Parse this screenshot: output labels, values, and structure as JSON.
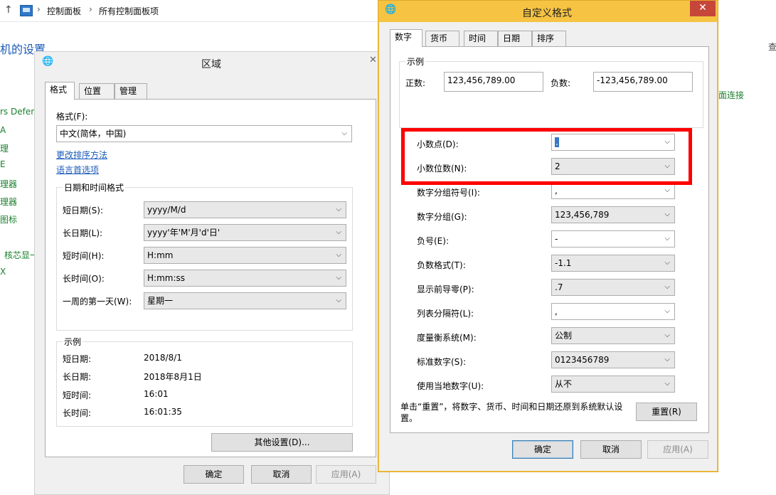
{
  "address_bar": {
    "crumbs": [
      "控制面板",
      "所有控制面板项"
    ]
  },
  "background": {
    "title": "机的设置",
    "items": [
      "rs Defend",
      "A",
      "理",
      "E",
      "理器",
      "理器",
      "图标",
      "核芯显一",
      "X"
    ],
    "right_text_1": "面连接",
    "right_text_2": "查"
  },
  "region_window": {
    "title": "区域",
    "tabs": [
      "格式",
      "位置",
      "管理"
    ],
    "format_label": "格式(F):",
    "format_value": "中文(简体，中国)",
    "link_sort": "更改排序方法",
    "link_lang": "语言首选项",
    "datetime_group": "日期和时间格式",
    "rows": [
      {
        "label": "短日期(S):",
        "value": "yyyy/M/d"
      },
      {
        "label": "长日期(L):",
        "value": "yyyy'年'M'月'd'日'"
      },
      {
        "label": "短时间(H):",
        "value": "H:mm"
      },
      {
        "label": "长时间(O):",
        "value": "H:mm:ss"
      },
      {
        "label": "一周的第一天(W):",
        "value": "星期一"
      }
    ],
    "example_group": "示例",
    "examples": [
      {
        "label": "短日期:",
        "value": "2018/8/1"
      },
      {
        "label": "长日期:",
        "value": "2018年8月1日"
      },
      {
        "label": "短时间:",
        "value": "16:01"
      },
      {
        "label": "长时间:",
        "value": "16:01:35"
      }
    ],
    "more_settings": "其他设置(D)...",
    "ok": "确定",
    "cancel": "取消",
    "apply": "应用(A)"
  },
  "custom_window": {
    "title": "自定义格式",
    "close": "✕",
    "tabs": [
      "数字",
      "货币",
      "时间",
      "日期",
      "排序"
    ],
    "example_group": "示例",
    "positive_label": "正数:",
    "positive_value": "123,456,789.00",
    "negative_label": "负数:",
    "negative_value": "-123,456,789.00",
    "rows": [
      {
        "label": "小数点(D):",
        "value": "."
      },
      {
        "label": "小数位数(N):",
        "value": "2"
      },
      {
        "label": "数字分组符号(I):",
        "value": ","
      },
      {
        "label": "数字分组(G):",
        "value": "123,456,789"
      },
      {
        "label": "负号(E):",
        "value": "-"
      },
      {
        "label": "负数格式(T):",
        "value": "-1.1"
      },
      {
        "label": "显示前导零(P):",
        "value": ".7"
      },
      {
        "label": "列表分隔符(L):",
        "value": ","
      },
      {
        "label": "度量衡系统(M):",
        "value": "公制"
      },
      {
        "label": "标准数字(S):",
        "value": "0123456789"
      },
      {
        "label": "使用当地数字(U):",
        "value": "从不"
      }
    ],
    "reset_note": "单击“重置”，将数字、货币、时间和日期还原到系统默认设置。",
    "reset": "重置(R)",
    "ok": "确定",
    "cancel": "取消",
    "apply": "应用(A)"
  },
  "colors": {
    "highlight": "#ff0000",
    "link": "#1a5bb8",
    "close_button": "#c7463a",
    "window_frame": "#f6c343"
  }
}
